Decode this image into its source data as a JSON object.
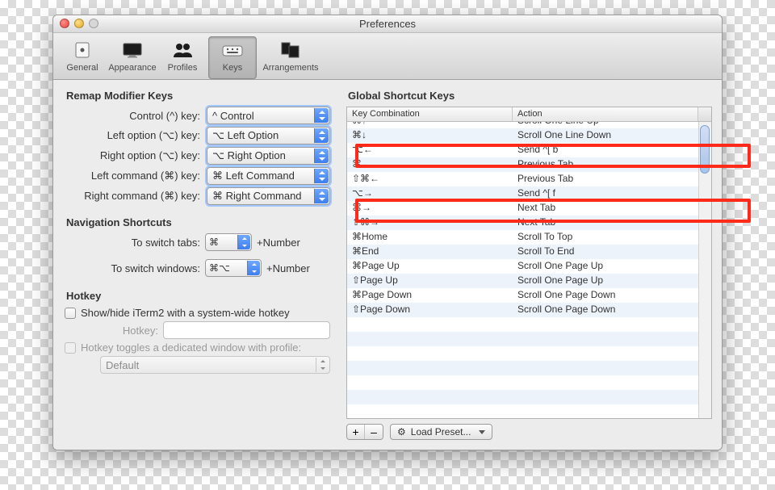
{
  "window": {
    "title": "Preferences"
  },
  "toolbar": {
    "items": [
      {
        "label": "General"
      },
      {
        "label": "Appearance"
      },
      {
        "label": "Profiles"
      },
      {
        "label": "Keys"
      },
      {
        "label": "Arrangements"
      }
    ]
  },
  "remap": {
    "title": "Remap Modifier Keys",
    "rows": [
      {
        "label": "Control (^) key:",
        "value": "^ Control"
      },
      {
        "label": "Left option (⌥) key:",
        "value": "⌥ Left Option"
      },
      {
        "label": "Right option (⌥) key:",
        "value": "⌥ Right Option"
      },
      {
        "label": "Left command (⌘) key:",
        "value": "⌘ Left Command"
      },
      {
        "label": "Right command (⌘) key:",
        "value": "⌘ Right Command"
      }
    ]
  },
  "nav": {
    "title": "Navigation Shortcuts",
    "tabs_label": "To switch tabs:",
    "tabs_value": "⌘",
    "windows_label": "To switch windows:",
    "windows_value": "⌘⌥",
    "suffix": "+Number"
  },
  "hotkey": {
    "title": "Hotkey",
    "showhide_label": "Show/hide iTerm2 with a system-wide hotkey",
    "hotkey_label": "Hotkey:",
    "toggle_label": "Hotkey toggles a dedicated window with profile:",
    "profile_value": "Default"
  },
  "shortcuts": {
    "title": "Global Shortcut Keys",
    "headers": {
      "key": "Key Combination",
      "action": "Action"
    },
    "rows": [
      {
        "key": "⌘↑",
        "action": "Scroll One Line Up"
      },
      {
        "key": "⌘↓",
        "action": "Scroll One Line Down"
      },
      {
        "key": "⌥←",
        "action": "Send ^[ b"
      },
      {
        "key": "⌘←",
        "action": "Previous Tab"
      },
      {
        "key": "⇧⌘←",
        "action": "Previous Tab"
      },
      {
        "key": "⌥→",
        "action": "Send ^[ f"
      },
      {
        "key": "⌘→",
        "action": "Next Tab"
      },
      {
        "key": "⇧⌘→",
        "action": "Next Tab"
      },
      {
        "key": "⌘Home",
        "action": "Scroll To Top"
      },
      {
        "key": "⌘End",
        "action": "Scroll To End"
      },
      {
        "key": "⌘Page Up",
        "action": "Scroll One Page Up"
      },
      {
        "key": "⇧Page Up",
        "action": "Scroll One Page Up"
      },
      {
        "key": "⌘Page Down",
        "action": "Scroll One Page Down"
      },
      {
        "key": "⇧Page Down",
        "action": "Scroll One Page Down"
      }
    ],
    "add": "+",
    "remove": "–",
    "preset_label": "Load Preset..."
  }
}
